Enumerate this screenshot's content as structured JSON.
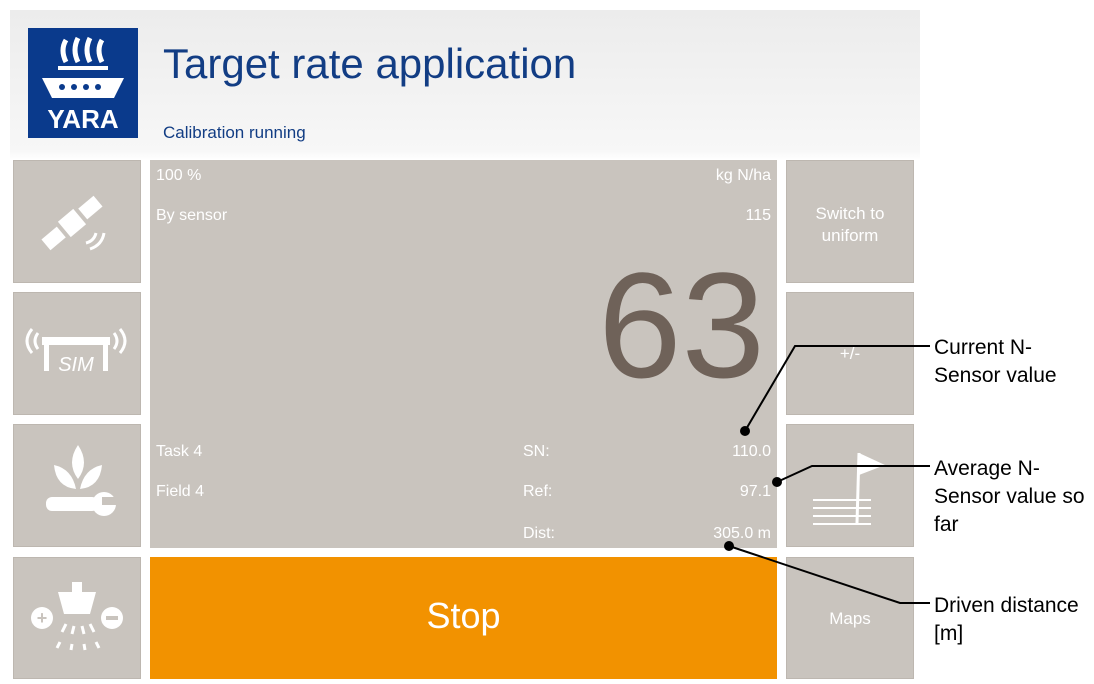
{
  "header": {
    "logo_text": "YARA",
    "title": "Target rate application",
    "subtitle": "Calibration running"
  },
  "left_buttons": [
    {
      "icon": "satellite-icon"
    },
    {
      "icon": "sim-sensor-icon"
    },
    {
      "icon": "plant-settings-icon"
    },
    {
      "icon": "spreader-rate-icon"
    }
  ],
  "right_buttons": {
    "switch_label": "Switch to uniform",
    "adjust_label": "+/-",
    "field_icon": "field-flag-icon",
    "maps_label": "Maps"
  },
  "panel": {
    "percent": "100 %",
    "unit": "kg N/ha",
    "mode": "By sensor",
    "mode_value": "115",
    "current_rate": "63",
    "task": "Task 4",
    "field": "Field 4",
    "sn_label": "SN:",
    "sn_value": "110.0",
    "ref_label": "Ref:",
    "ref_value": "97.1",
    "dist_label": "Dist:",
    "dist_value": "305.0 m"
  },
  "stop_button": {
    "label": "Stop",
    "color": "#f29200"
  },
  "annotations": {
    "current": "Current N-Sensor value",
    "average": "Average N-Sensor value so far",
    "distance": "Driven distance [m]"
  },
  "colors": {
    "brand": "#0a3a8c",
    "button_gray": "#c9c4be",
    "big_number": "#6f6259"
  }
}
